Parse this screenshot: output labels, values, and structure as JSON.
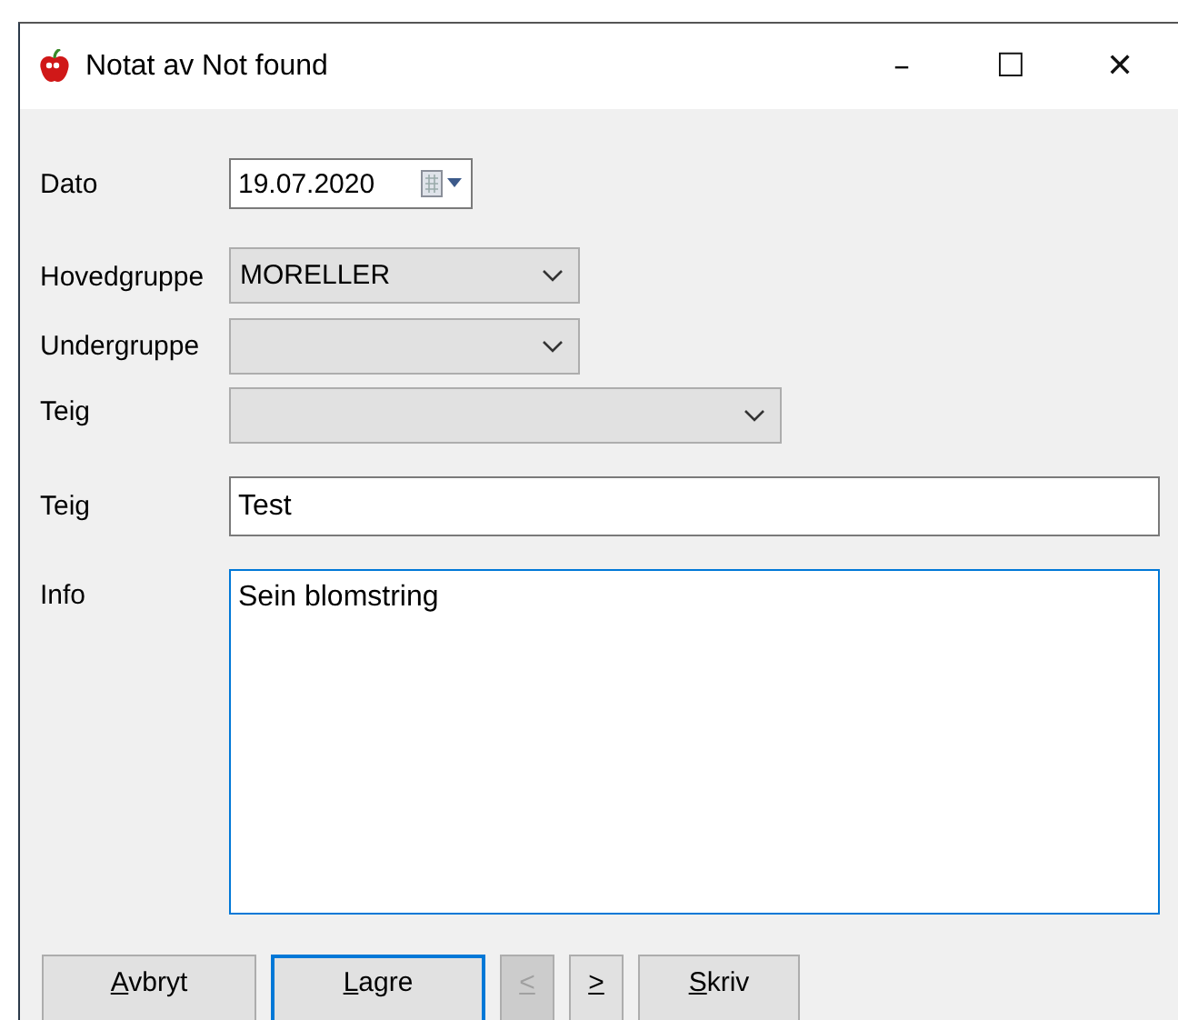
{
  "window": {
    "title": "Notat av Not found",
    "controls": [
      "–",
      "☐",
      "✕"
    ]
  },
  "fields": [
    {
      "kind": "date",
      "label": "Dato",
      "value": "19.07.2020"
    },
    {
      "kind": "combo",
      "label": "Hovedgruppe",
      "value": "MORELLER"
    },
    {
      "kind": "combo",
      "label": "Undergruppe"
    },
    {
      "kind": "widecombo",
      "label": "Teig"
    },
    {
      "kind": "text",
      "label": "Teig",
      "value": "Test"
    },
    {
      "kind": "memo",
      "label": "Info",
      "value": "Sein blomstring",
      "focused": true
    }
  ],
  "buttons": [
    {
      "label": "Avbryt",
      "disabled": false,
      "focused": false
    },
    {
      "label": "Lagre",
      "disabled": false,
      "focused": true
    },
    {
      "label": "<",
      "disabled": true,
      "focused": false
    },
    {
      "label": ">",
      "disabled": false,
      "focused": false
    },
    {
      "label": "Skriv",
      "disabled": false,
      "focused": false
    }
  ]
}
